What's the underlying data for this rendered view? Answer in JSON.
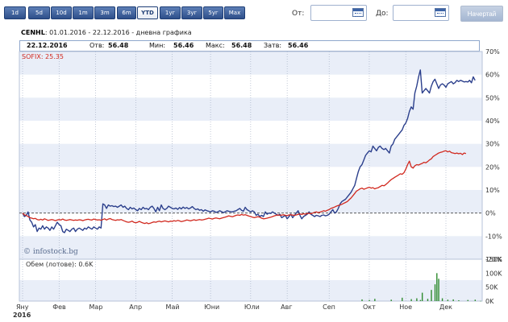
{
  "toolbar": {
    "ranges": [
      "1d",
      "5d",
      "10d",
      "1m",
      "3m",
      "6m",
      "YTD",
      "1yr",
      "3yr",
      "5yr",
      "Max"
    ],
    "ranges_display": [
      "1d",
      "5d",
      "10d",
      "1m",
      "3m",
      "6m",
      "YTD",
      "1уг",
      "3уг",
      "5уг",
      "Мах"
    ],
    "active_range": "YTD",
    "from_label": "От:",
    "to_label": "До:",
    "from_value": "",
    "to_value": "",
    "go_label": "Начертай"
  },
  "header": {
    "symbol": "CENHL",
    "range_text": "01.01.2016 - 22.12.2016",
    "chart_kind": "дневна графика"
  },
  "quote": {
    "date": "22.12.2016",
    "open_label": "Отв:",
    "open": "56.48",
    "low_label": "Мин:",
    "low": "56.46",
    "high_label": "Макс:",
    "high": "56.48",
    "close_label": "Затв:",
    "close": "56.46"
  },
  "colors": {
    "stock": "#2b3f8c",
    "index": "#d1281e",
    "band": "#e9eef8",
    "grid": "#9aa6bd",
    "volume": "#2e8b2e"
  },
  "chart_data": {
    "type": "line",
    "x_unit": "trading-day index from 4 Jan 2016",
    "x": [
      0,
      1,
      2,
      3,
      4,
      5,
      6,
      7,
      8,
      9,
      10,
      11,
      12,
      13,
      14,
      15,
      16,
      17,
      18,
      19,
      20,
      21,
      22,
      23,
      24,
      25,
      26,
      27,
      28,
      29,
      30,
      31,
      32,
      33,
      34,
      35,
      36,
      37,
      38,
      39,
      40,
      41,
      42,
      43,
      44,
      45,
      46,
      47,
      48,
      49,
      50,
      51,
      52,
      53,
      54,
      55,
      56,
      57,
      58,
      59,
      60,
      61,
      62,
      63,
      64,
      65,
      66,
      67,
      68,
      69,
      70,
      71,
      72,
      73,
      74,
      75,
      76,
      77,
      78,
      79,
      80,
      81,
      82,
      83,
      84,
      85,
      86,
      87,
      88,
      89,
      90,
      91,
      92,
      93,
      94,
      95,
      96,
      97,
      98,
      99,
      100,
      101,
      102,
      103,
      104,
      105,
      106,
      107,
      108,
      109,
      110,
      111,
      112,
      113,
      114,
      115,
      116,
      117,
      118,
      119,
      120,
      121,
      122,
      123,
      124,
      125,
      126,
      127,
      128,
      129,
      130,
      131,
      132,
      133,
      134,
      135,
      136,
      137,
      138,
      139,
      140,
      141,
      142,
      143,
      144,
      145,
      146,
      147,
      148,
      149,
      150,
      151,
      152,
      153,
      154,
      155,
      156,
      157,
      158,
      159,
      160,
      161,
      162,
      163,
      164,
      165,
      166,
      167,
      168,
      169,
      170,
      171,
      172,
      173,
      174,
      175,
      176,
      177,
      178,
      179,
      180,
      181,
      182,
      183,
      184,
      185,
      186,
      187,
      188,
      189,
      190,
      191,
      192,
      193,
      194,
      195,
      196,
      197,
      198,
      199,
      200,
      201,
      202,
      203,
      204,
      205,
      206,
      207,
      208,
      209,
      210,
      211,
      212,
      213,
      214,
      215,
      216,
      217,
      218,
      219,
      220,
      221,
      222,
      223,
      224,
      225,
      226,
      227,
      228,
      229,
      230,
      231,
      232,
      233,
      234,
      235,
      236,
      237,
      238,
      239,
      240,
      241,
      242,
      243,
      244,
      245,
      246,
      247,
      248,
      249,
      250,
      251
    ],
    "series": [
      {
        "name": "CENHL",
        "color": "#2b3f8c",
        "values": [
          0,
          -1.5,
          -1,
          0.5,
          -3,
          -4,
          -6,
          -5,
          -8,
          -6.5,
          -7,
          -5.5,
          -7,
          -6,
          -6.5,
          -7.5,
          -6,
          -7,
          -5.5,
          -4,
          -5,
          -5.5,
          -8,
          -8.5,
          -7,
          -7.5,
          -8,
          -7,
          -6.5,
          -8,
          -7,
          -6.5,
          -7,
          -7.5,
          -6.5,
          -7,
          -6,
          -6.5,
          -7,
          -6,
          -6.5,
          -7,
          -6,
          -6.5,
          4,
          3.5,
          2,
          3.5,
          3,
          3.2,
          2.8,
          3,
          2.5,
          3,
          3.5,
          2.5,
          3,
          2,
          1.5,
          2.5,
          1.8,
          2.2,
          1.5,
          1,
          2,
          1.5,
          2.5,
          1.8,
          2,
          1.5,
          2.5,
          3,
          2,
          0.5,
          2.5,
          1,
          3.5,
          2,
          1.5,
          2,
          3,
          2.5,
          2,
          1.8,
          2.2,
          1.6,
          2.4,
          1.8,
          2.6,
          2,
          2.4,
          1.8,
          2.2,
          2.8,
          2,
          1.5,
          1.8,
          1.2,
          1.5,
          0.8,
          1.4,
          1,
          0.8,
          0.5,
          1,
          0.8,
          0.3,
          0.5,
          1,
          0.6,
          0.2,
          0.5,
          1,
          0.8,
          0.6,
          0.5,
          0.8,
          1,
          1.5,
          2,
          1.2,
          0.8,
          2.5,
          1.5,
          1,
          0.5,
          1,
          0.5,
          -1,
          -0.5,
          -1.5,
          -1,
          -1.5,
          0.5,
          -0.5,
          0,
          -0.2,
          0.5,
          0,
          -0.5,
          -1,
          -0.5,
          -2,
          -1.5,
          -1,
          -2.5,
          -1.5,
          -0.5,
          -2,
          -1,
          0,
          1,
          -1,
          -2.5,
          -1.5,
          -1,
          -0.5,
          0.5,
          -0.5,
          -1,
          -1.5,
          -1,
          -1.2,
          -1.5,
          -1,
          -0.8,
          -1.2,
          -1,
          -0.5,
          0.5,
          1.5,
          0,
          0.5,
          2,
          4,
          5,
          5.5,
          6,
          7,
          8,
          9,
          10.5,
          12,
          15,
          18,
          20,
          21,
          23,
          25,
          26,
          27,
          26.5,
          29,
          28,
          27,
          28.5,
          29,
          28,
          27.5,
          28,
          27,
          26,
          29,
          30,
          32,
          33,
          34,
          35,
          36,
          38,
          39,
          41,
          44,
          46,
          45,
          52,
          55,
          59,
          62,
          52,
          53,
          54,
          53,
          52,
          55,
          57,
          58,
          56,
          54,
          55.5,
          56,
          55.5,
          54.5,
          56,
          56.5,
          57,
          56,
          56.5,
          57.5,
          57,
          57.5,
          57.2,
          56.8,
          57,
          56.8,
          57.5,
          56.46,
          59,
          57.5
        ],
        "label": "CENHL"
      },
      {
        "name": "SOFIX",
        "color": "#d1281e",
        "values": [
          0,
          -0.8,
          -1,
          -1.5,
          -2,
          -2.2,
          -2.5,
          -2.3,
          -2.8,
          -3,
          -2.7,
          -3,
          -2.5,
          -2.8,
          -3.2,
          -3,
          -2.8,
          -3,
          -3.3,
          -3,
          -2.8,
          -3,
          -2.6,
          -3,
          -3.2,
          -3,
          -2.8,
          -3,
          -3.2,
          -3,
          -3.1,
          -2.9,
          -3,
          -3.3,
          -3,
          -2.8,
          -2.7,
          -2.9,
          -3,
          -2.6,
          -2.8,
          -3,
          -2.9,
          -3.1,
          -2.8,
          -2.5,
          -3,
          -2.6,
          -2.4,
          -2.8,
          -3,
          -3.2,
          -2.9,
          -3,
          -2.8,
          -3.2,
          -3.5,
          -3.8,
          -4,
          -3.8,
          -3.5,
          -4,
          -4.2,
          -4,
          -3.6,
          -4,
          -4.3,
          -4.5,
          -4.2,
          -4.6,
          -4.4,
          -4.1,
          -3.8,
          -4,
          -3.7,
          -3.5,
          -3.8,
          -3.6,
          -3.4,
          -3.6,
          -3.8,
          -3.5,
          -3.6,
          -3.3,
          -3.5,
          -3.2,
          -3.4,
          -3.7,
          -3.5,
          -3.3,
          -3,
          -3.2,
          -3.4,
          -3.1,
          -2.9,
          -3.2,
          -3,
          -2.8,
          -3,
          -2.9,
          -2.7,
          -2.5,
          -2.2,
          -2.4,
          -2.6,
          -2.3,
          -2.1,
          -2.3,
          -2.5,
          -2.2,
          -2,
          -1.8,
          -1.5,
          -1.2,
          -1.4,
          -1.6,
          -1.3,
          -1,
          -0.8,
          -1,
          -0.6,
          -0.9,
          -0.7,
          -1,
          -1.3,
          -1.5,
          -1.8,
          -2,
          -1.8,
          -1.6,
          -1.8,
          -2.2,
          -2.5,
          -2.4,
          -2.2,
          -2,
          -1.8,
          -1.5,
          -1.2,
          -1,
          -0.8,
          -1,
          -0.9,
          -0.7,
          -1,
          -1.1,
          -0.8,
          -0.7,
          -0.9,
          -1,
          -0.8,
          -0.6,
          -0.4,
          -0.6,
          -0.3,
          -0.5,
          -0.2,
          -0.1,
          -0.3,
          0,
          0.3,
          0.5,
          0.2,
          0.4,
          0.7,
          1,
          0.8,
          1.2,
          1.5,
          2,
          2.3,
          2.6,
          3,
          3.3,
          3.5,
          3.8,
          4.2,
          4.6,
          5,
          5.8,
          6.5,
          7.5,
          8.5,
          9.5,
          10,
          10.5,
          10.8,
          10.3,
          10.6,
          10.9,
          11.2,
          10.8,
          11,
          10.5,
          10.8,
          11,
          11.5,
          12,
          11.8,
          12.3,
          13,
          13.8,
          14.5,
          15,
          15.5,
          16,
          16.5,
          17,
          16.8,
          17.5,
          19,
          21,
          22.5,
          20,
          19.5,
          20.5,
          21,
          20.8,
          21.2,
          21.5,
          22,
          21.8,
          22.3,
          23,
          23.5,
          24.5,
          25,
          25.5,
          26,
          26.3,
          26.5,
          26.8,
          27,
          26.5,
          26.8,
          26.2,
          26,
          25.8,
          26,
          25.7,
          25.9,
          25.35,
          26,
          25.8
        ],
        "label": "SOFIX: 25.35"
      }
    ],
    "volume": {
      "label": "Обем (лотове): 0.6K",
      "x": [
        186,
        190,
        193,
        202,
        208,
        213,
        216,
        218,
        219,
        222,
        224,
        226,
        227,
        228,
        230,
        233,
        236,
        239,
        244,
        248,
        251
      ],
      "values": [
        6000,
        4000,
        8000,
        5000,
        12000,
        7000,
        10000,
        4000,
        30000,
        8000,
        40000,
        60000,
        100000,
        80000,
        10000,
        5000,
        6000,
        3000,
        4000,
        5000,
        600
      ],
      "axis_ticks": [
        "150K",
        "100K",
        "50K",
        "0K"
      ],
      "ylim": [
        0,
        150000
      ]
    },
    "y_ticks": [
      "70%",
      "60%",
      "50%",
      "40%",
      "30%",
      "20%",
      "10%",
      "0%",
      "-10%",
      "-20%"
    ],
    "ylim": [
      -20,
      70
    ],
    "x_ticks": [
      {
        "label": "Яну",
        "x": 0
      },
      {
        "label": "Фев",
        "x": 20
      },
      {
        "label": "Мар",
        "x": 40
      },
      {
        "label": "Апр",
        "x": 62
      },
      {
        "label": "Май",
        "x": 82
      },
      {
        "label": "Юни",
        "x": 103
      },
      {
        "label": "Юли",
        "x": 125
      },
      {
        "label": "Авг",
        "x": 145
      },
      {
        "label": "Сеп",
        "x": 168
      },
      {
        "label": "Окт",
        "x": 190
      },
      {
        "label": "Ное",
        "x": 210
      },
      {
        "label": "Дек",
        "x": 232
      }
    ],
    "x_year": "2016",
    "watermark": "© infostock.bg",
    "grid": true
  }
}
